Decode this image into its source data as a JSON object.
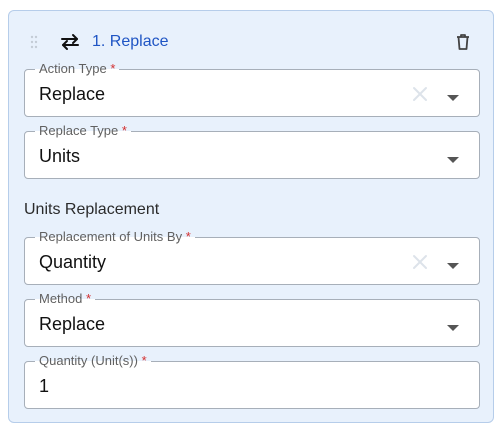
{
  "rule": {
    "title": "1. Replace",
    "icons": {
      "drag": "drag-handle-icon",
      "action": "swap-arrows-icon",
      "delete": "trash-icon"
    }
  },
  "fields": {
    "action_type": {
      "label": "Action Type",
      "required_mark": "*",
      "value": "Replace"
    },
    "replace_type": {
      "label": "Replace Type",
      "required_mark": "*",
      "value": "Units"
    },
    "replacement_of_units_by": {
      "label": "Replacement of Units By",
      "required_mark": "*",
      "value": "Quantity"
    },
    "method": {
      "label": "Method",
      "required_mark": "*",
      "value": "Replace"
    },
    "quantity": {
      "label": "Quantity (Unit(s))",
      "required_mark": "*",
      "value": "1"
    }
  },
  "section": {
    "title": "Units Replacement"
  },
  "colors": {
    "card_background": "#e8f1fc",
    "card_border": "#b6cdea",
    "title_blue": "#1f55c4",
    "required_red": "#d32f2f",
    "field_border": "#a7afb9"
  }
}
